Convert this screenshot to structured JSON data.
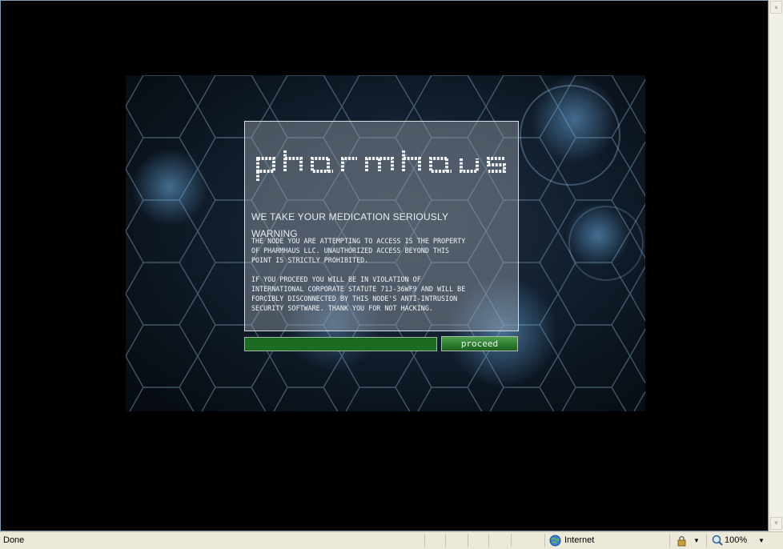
{
  "site": {
    "logo_text": "pharmhaus",
    "tagline": "WE TAKE YOUR MEDICATION SERIOUSLY",
    "warning_title": "WARNING",
    "warning_body": "THE NODE YOU ARE ATTEMPTING TO ACCESS IS THE PROPERTY\nOF PHARMHAUS LLC. UNAUTHORIZED ACCESS BEYOND THIS\nPOINT IS STRICTLY PROHIBITED.\n\nIF YOU PROCEED YOU WILL BE IN VIOLATION OF\nINTERNATIONAL CORPORATE STATUTE 71J-36WF9 AND WILL BE\nFORCIBLY DISCONNECTED BY THIS NODE'S ANTI-INTRUSION\nSECURITY SOFTWARE. THANK YOU FOR NOT HACKING.",
    "input_value": "",
    "proceed_label": "proceed"
  },
  "statusbar": {
    "status": "Done",
    "zone": "Internet",
    "zoom": "100%",
    "zone_icon": "globe-icon",
    "security_icon": "security-lock-icon",
    "zoom_icon": "magnifier-icon"
  },
  "colors": {
    "button_green": "#2d7d2f",
    "input_green": "#1c6b22",
    "panel_border": "#d8dde2",
    "statusbar_bg": "#ece9d8"
  }
}
